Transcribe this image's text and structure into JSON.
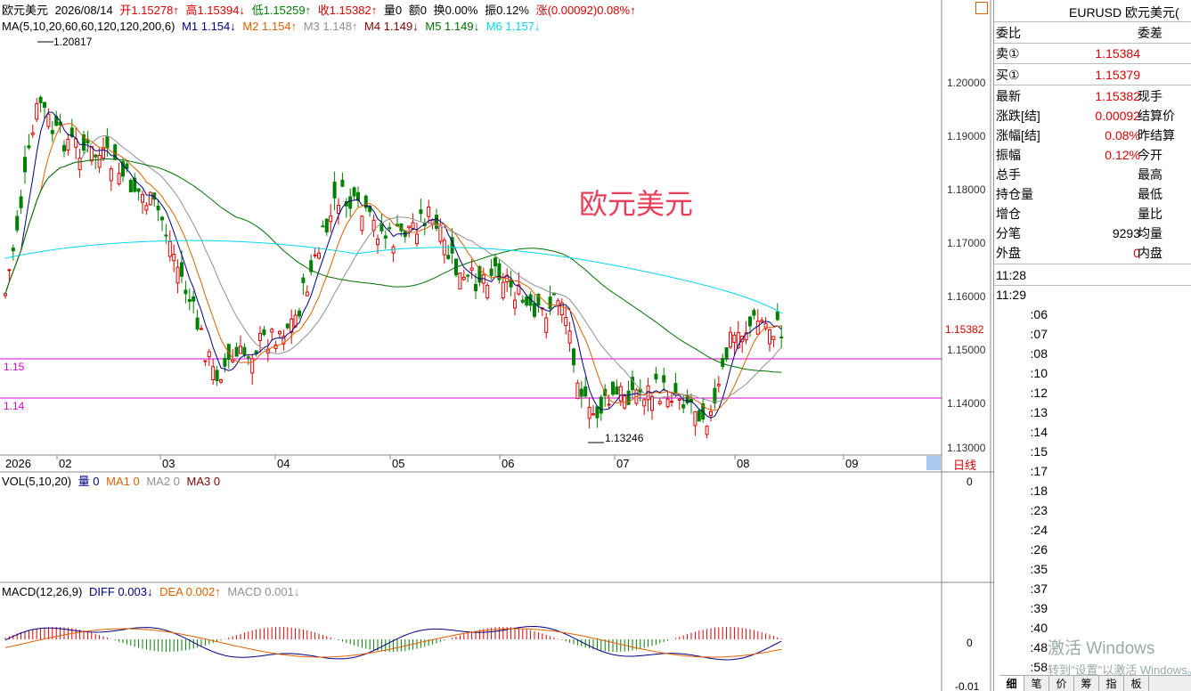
{
  "header": {
    "symbol": "欧元美元",
    "date": "2026/08/14",
    "open": "开1.15278↑",
    "high": "高1.15394↓",
    "low": "低1.15259↑",
    "close": "收1.15382↑",
    "volume": "量0",
    "amount": "额0",
    "turnover": "换0.00%",
    "amplitude": "振0.12%",
    "change": "涨(0.00092)0.08%↑"
  },
  "ma_legend": {
    "label": "MA(5,10,20,60,60,120,120,200,6)",
    "m1": "M1 1.154↓",
    "m2": "M2 1.154↑",
    "m3": "M3 1.148↑",
    "m4": "M4 1.149↓",
    "m5": "M5 1.149↓",
    "m6": "M6 1.157↓"
  },
  "chart_title": "欧元美元",
  "annotations": {
    "high": "1.20817",
    "low": "1.13246",
    "last": "1.15382",
    "hline1": "1.15",
    "hline2": "1.14"
  },
  "price_axis": [
    "1.20000",
    "1.19000",
    "1.18000",
    "1.17000",
    "1.16000",
    "1.15000",
    "1.14000",
    "1.13000"
  ],
  "time_axis": [
    "2026",
    "02",
    "03",
    "04",
    "05",
    "06",
    "07",
    "08",
    "09"
  ],
  "period_button": "日线",
  "vol_legend": {
    "label": "VOL(5,10,20)",
    "v": "量 0",
    "ma1": "MA1 0",
    "ma2": "MA2 0",
    "ma3": "MA3 0",
    "axis": "0"
  },
  "macd_legend": {
    "label": "MACD(12,26,9)",
    "diff": "DIFF 0.003↓",
    "dea": "DEA 0.002↑",
    "macd": "MACD 0.001↓",
    "axis0": "0",
    "axis_neg": "-0.01"
  },
  "quote_panel": {
    "title": "EURUSD 欧元美元(",
    "bid_ratio": "委比",
    "bid_diff": "委差",
    "sell_label": "卖①",
    "sell_value": "1.15384",
    "buy_label": "买①",
    "buy_value": "1.15379",
    "rows": [
      {
        "k": "最新",
        "v": "1.15382",
        "k2": "现手"
      },
      {
        "k": "涨跌[结]",
        "v": "0.00092",
        "k2": "结算价"
      },
      {
        "k": "涨幅[结]",
        "v": "0.08%",
        "k2": "昨结算"
      },
      {
        "k": "振幅",
        "v": "0.12%",
        "k2": "今开"
      },
      {
        "k": "总手",
        "v": "",
        "k2": "最高"
      },
      {
        "k": "持仓量",
        "v": "",
        "k2": "最低"
      },
      {
        "k": "增仓",
        "v": "",
        "k2": "量比"
      },
      {
        "k": "分笔",
        "v": "9293",
        "k2": "均量"
      },
      {
        "k": "外盘",
        "v": "0",
        "k2": "内盘"
      }
    ],
    "ticks": [
      "11:28",
      "11:29",
      ":06",
      ":07",
      ":08",
      ":10",
      ":12",
      ":13",
      ":14",
      ":15",
      ":17",
      ":18",
      ":23",
      ":24",
      ":26",
      ":35",
      ":37",
      ":39",
      ":40",
      ":48",
      ":58"
    ]
  },
  "tabs": [
    "细",
    "笔",
    "价",
    "筹",
    "指",
    "板"
  ],
  "watermark": {
    "line1": "激活 Windows",
    "line2": "转到\"设置\"以激活 Windows。"
  },
  "colors": {
    "up": "#e00000",
    "down": "#008000",
    "ma1": "#000080",
    "ma2": "#e06000",
    "ma3": "#909090",
    "ma4": "#800000",
    "ma5": "#007000",
    "ma6": "#00d8e8",
    "hline": "#e000e0"
  }
}
